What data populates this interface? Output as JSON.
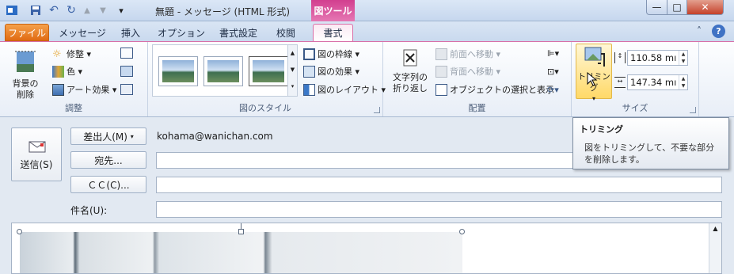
{
  "window": {
    "title": "無題 - メッセージ (HTML 形式)",
    "contextual_tab_group": "図ツール",
    "minimize_glyph": "—",
    "maximize_glyph": "□",
    "close_glyph": "✕",
    "help_glyph": "?",
    "collapse_glyph": "˄",
    "qat_customize_glyph": "▾"
  },
  "tabs": [
    {
      "label": "ファイル"
    },
    {
      "label": "メッセージ"
    },
    {
      "label": "挿入"
    },
    {
      "label": "オプション"
    },
    {
      "label": "書式設定"
    },
    {
      "label": "校閲"
    },
    {
      "label": "書式",
      "active": true
    }
  ],
  "ribbon": {
    "adjust": {
      "label": "調整",
      "remove_background_line1": "背景の",
      "remove_background_line2": "削除",
      "corrections": "修整",
      "color": "色",
      "artistic_effects": "アート効果"
    },
    "picture_styles": {
      "label": "図のスタイル",
      "border": "図の枠線",
      "effects": "図の効果",
      "layout": "図のレイアウト"
    },
    "arrange": {
      "label": "配置",
      "wrap_line1": "文字列の",
      "wrap_line2": "折り返し",
      "bring_forward": "前面へ移動",
      "send_backward": "背面へ移動",
      "selection_pane": "オブジェクトの選択と表示"
    },
    "size": {
      "label": "サイズ",
      "crop": "トリミング",
      "height": "110.58 mı",
      "width": "147.34 mı"
    }
  },
  "compose": {
    "send": "送信(S)",
    "from_button": "差出人(M)",
    "from_value": "kohama@wanichan.com",
    "to_button": "宛先...",
    "cc_button": "ＣＣ(C)...",
    "subject_label": "件名(U):"
  },
  "tooltip": {
    "title": "トリミング",
    "body": "図をトリミングして、不要な部分を削除します。"
  },
  "colors": {
    "file_tab": "#e06a12",
    "contextual_accent": "#d86fa8"
  }
}
